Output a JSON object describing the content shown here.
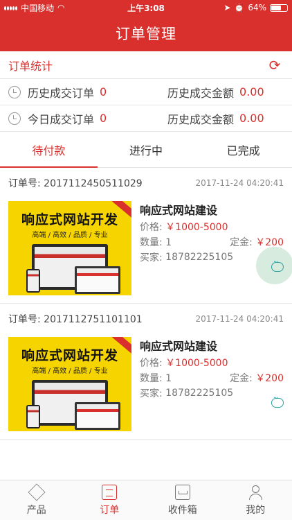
{
  "status_bar": {
    "carrier": "中国移动",
    "time": "上午3:08",
    "battery": "64%",
    "battery_level": 0.64
  },
  "header": {
    "title": "订单管理"
  },
  "stats": {
    "title": "订单统计",
    "rows": [
      {
        "left_label": "历史成交订单",
        "left_value": "0",
        "right_label": "历史成交金额",
        "right_value": "0.00"
      },
      {
        "left_label": "今日成交订单",
        "left_value": "0",
        "right_label": "历史成交金额",
        "right_value": "0.00"
      }
    ]
  },
  "tabs": [
    {
      "label": "待付款",
      "active": true
    },
    {
      "label": "进行中",
      "active": false
    },
    {
      "label": "已完成",
      "active": false
    }
  ],
  "orders": [
    {
      "order_no_label": "订单号:",
      "order_no": "2017112450511029",
      "time": "2017-11-24 04:20:41",
      "image_title": "响应式网站开发",
      "image_sub": "高端 / 高效 / 品质 / 专业",
      "product_name": "响应式网站建设",
      "price_label": "价格:",
      "price": "￥1000-5000",
      "qty_label": "数量:",
      "qty": "1",
      "deposit_label": "定金:",
      "deposit": "￥200",
      "buyer_label": "买家:",
      "buyer": "18782225105"
    },
    {
      "order_no_label": "订单号:",
      "order_no": "2017112751101101",
      "time": "2017-11-24 04:20:41",
      "image_title": "响应式网站开发",
      "image_sub": "高端 / 高效 / 品质 / 专业",
      "product_name": "响应式网站建设",
      "price_label": "价格:",
      "price": "￥1000-5000",
      "qty_label": "数量:",
      "qty": "1",
      "deposit_label": "定金:",
      "deposit": "￥200",
      "buyer_label": "买家:",
      "buyer": "18782225105"
    }
  ],
  "bottom_nav": [
    {
      "label": "产品",
      "icon": "box-icon",
      "active": false
    },
    {
      "label": "订单",
      "icon": "clipboard-icon",
      "active": true
    },
    {
      "label": "收件箱",
      "icon": "inbox-icon",
      "active": false
    },
    {
      "label": "我的",
      "icon": "user-icon",
      "active": false
    }
  ],
  "colors": {
    "brand": "#d9302e",
    "accent_chat": "#2aa2a2"
  }
}
